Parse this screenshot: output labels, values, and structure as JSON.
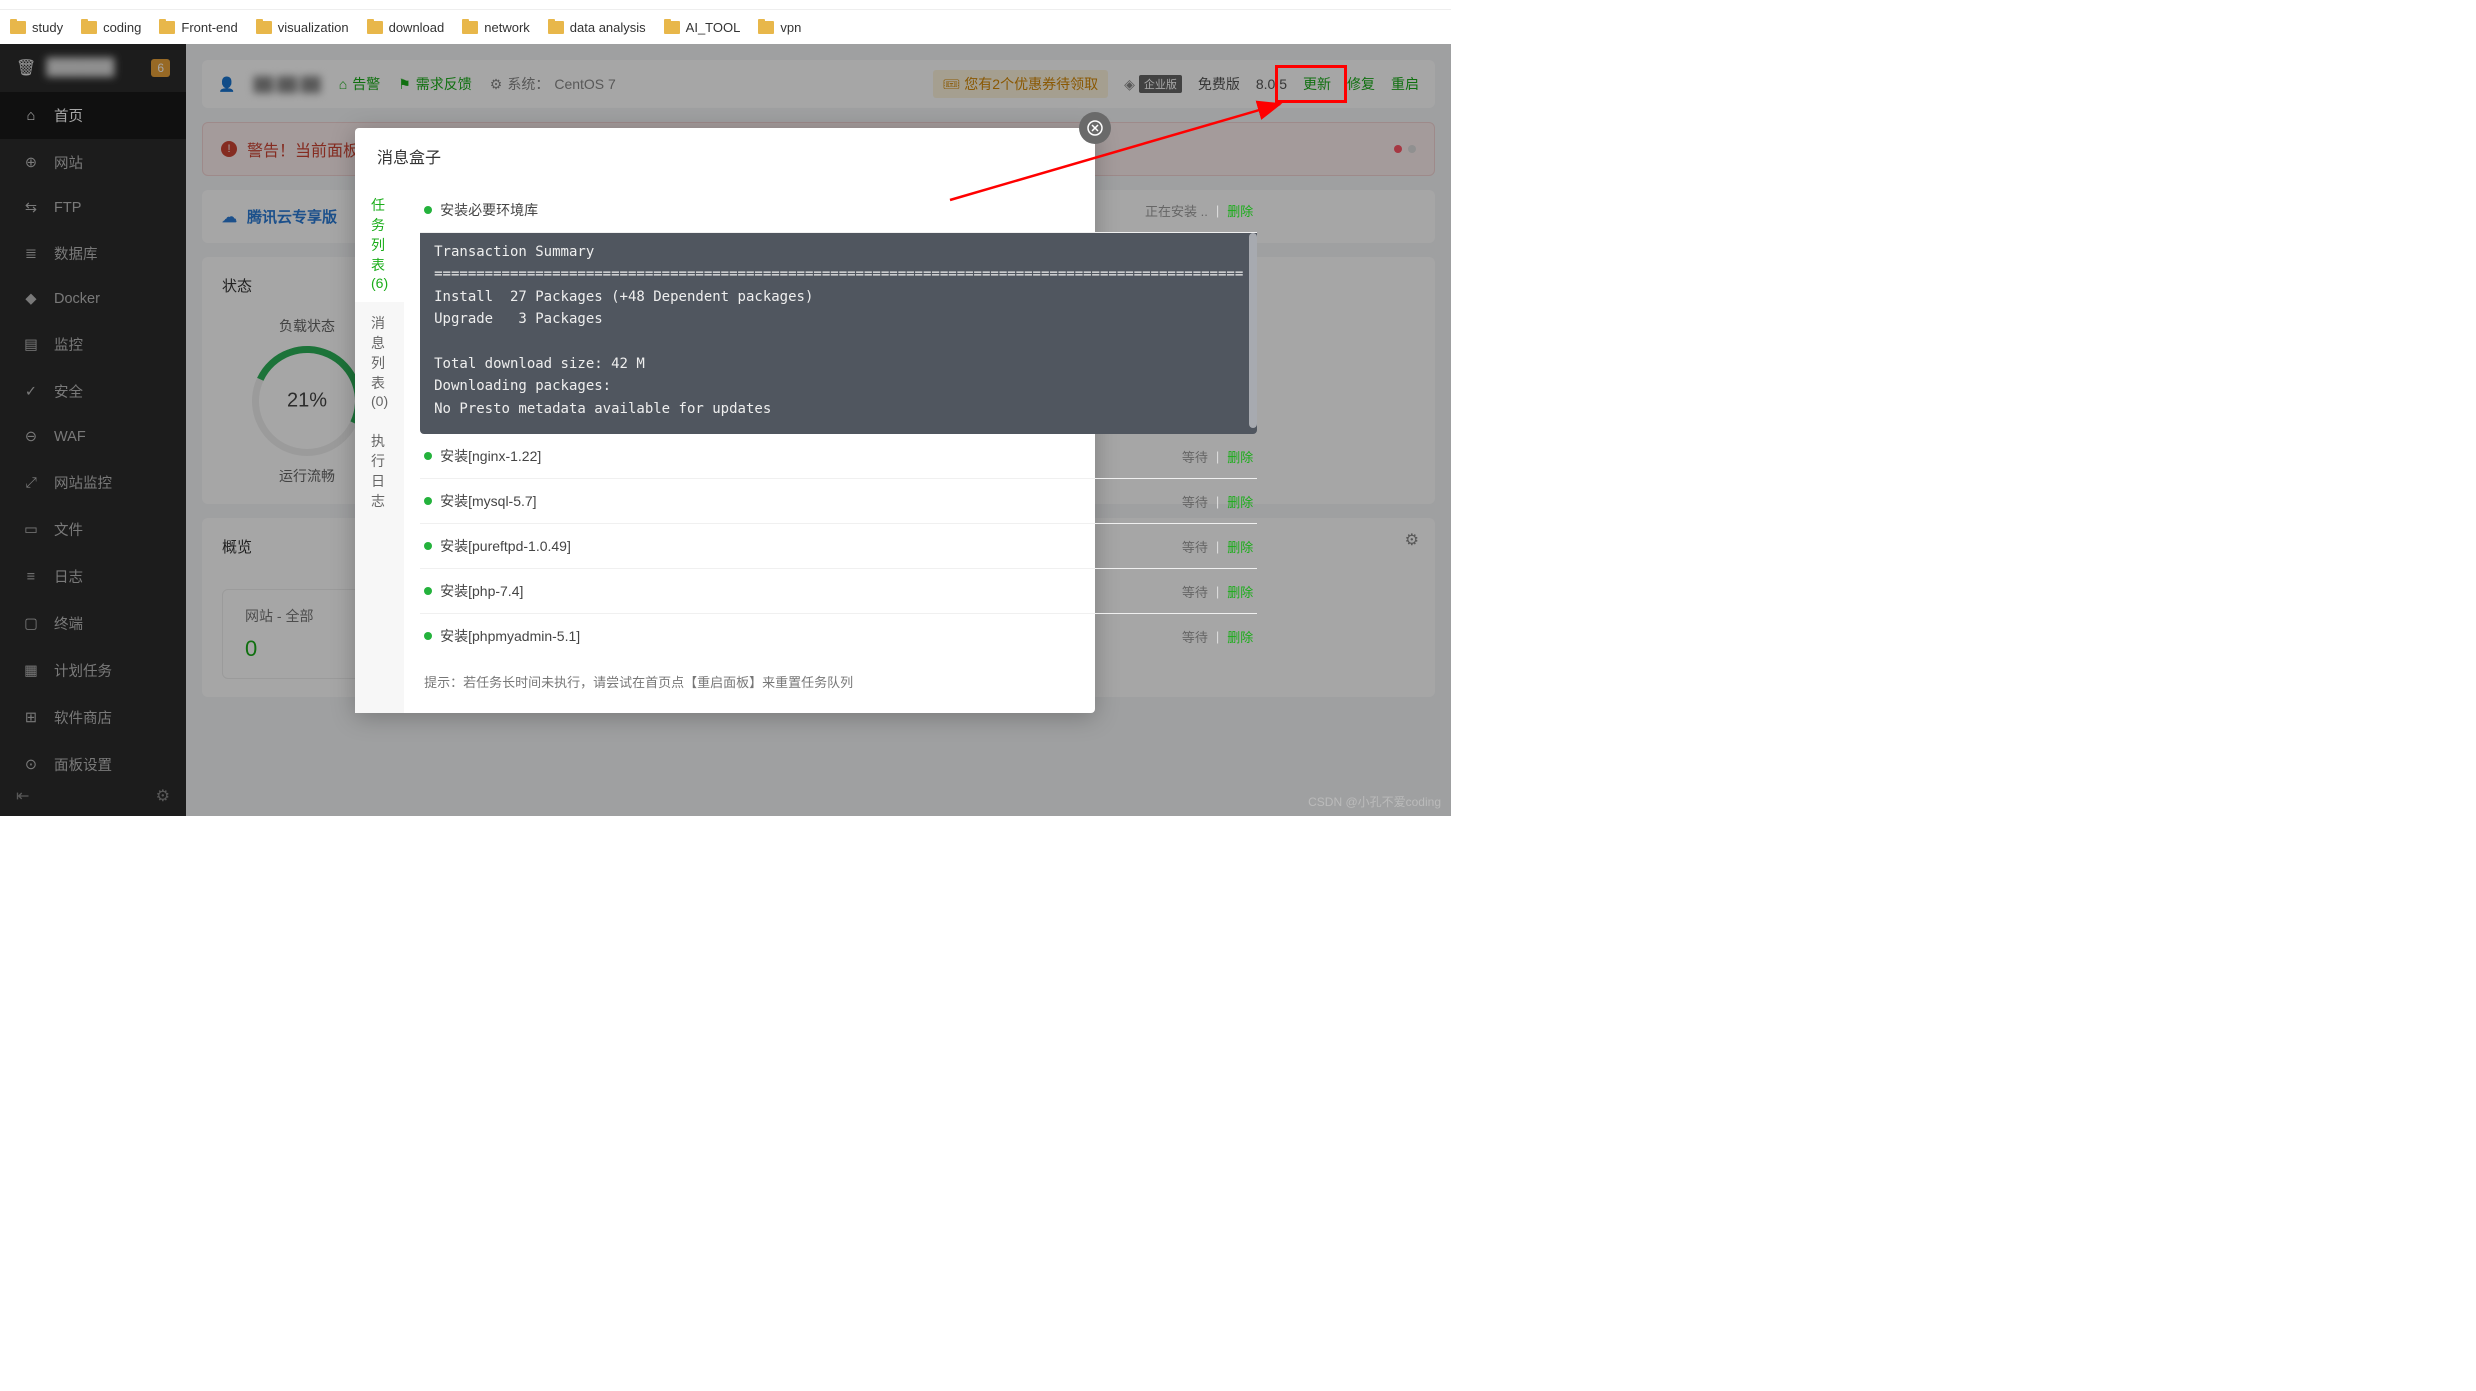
{
  "bookmarks": [
    "study",
    "coding",
    "Front-end",
    "visualization",
    "download",
    "network",
    "data analysis",
    "AI_TOOL",
    "vpn"
  ],
  "sidebar": {
    "badge": "6",
    "items": [
      {
        "label": "首页",
        "icon": "home"
      },
      {
        "label": "网站",
        "icon": "globe"
      },
      {
        "label": "FTP",
        "icon": "ftp"
      },
      {
        "label": "数据库",
        "icon": "db"
      },
      {
        "label": "Docker",
        "icon": "docker"
      },
      {
        "label": "监控",
        "icon": "monitor"
      },
      {
        "label": "安全",
        "icon": "shield"
      },
      {
        "label": "WAF",
        "icon": "waf"
      },
      {
        "label": "网站监控",
        "icon": "sitemon"
      },
      {
        "label": "文件",
        "icon": "folder"
      },
      {
        "label": "日志",
        "icon": "log"
      },
      {
        "label": "终端",
        "icon": "terminal"
      },
      {
        "label": "计划任务",
        "icon": "cron"
      },
      {
        "label": "软件商店",
        "icon": "store"
      },
      {
        "label": "面板设置",
        "icon": "settings"
      }
    ]
  },
  "topbar": {
    "alarm": "告警",
    "feedback": "需求反馈",
    "system_prefix": "系统：",
    "system": "CentOS 7",
    "coupon": "您有2个优惠券待领取",
    "enterprise": "企业版",
    "free": "免费版",
    "version": "8.0.5",
    "update": "更新",
    "repair": "修复",
    "restart": "重启"
  },
  "alert": {
    "text": "警告！当前面板使"
  },
  "tencent": {
    "label": "腾讯云专享版"
  },
  "status": {
    "title": "状态",
    "gauge_title": "负载状态",
    "gauge_value": "21%",
    "gauge_label": "运行流畅"
  },
  "overview": {
    "title": "概览",
    "card_title": "网站 - 全部",
    "card_value": "0"
  },
  "modal": {
    "title": "消息盒子",
    "tabs": {
      "tasks": "任务列表 (6)",
      "messages": "消息列表 (0)",
      "logs": "执行日志"
    },
    "tasks": [
      {
        "name": "安装必要环境库",
        "status": "正在安装 ..",
        "remove": "删除"
      },
      {
        "name": "安装[nginx-1.22]",
        "status": "等待",
        "remove": "删除"
      },
      {
        "name": "安装[mysql-5.7]",
        "status": "等待",
        "remove": "删除"
      },
      {
        "name": "安装[pureftpd-1.0.49]",
        "status": "等待",
        "remove": "删除"
      },
      {
        "name": "安装[php-7.4]",
        "status": "等待",
        "remove": "删除"
      },
      {
        "name": "安装[phpmyadmin-5.1]",
        "status": "等待",
        "remove": "删除"
      }
    ],
    "terminal": "Transaction Summary\n================================================================================================\nInstall  27 Packages (+48 Dependent packages)\nUpgrade   3 Packages\n\nTotal download size: 42 M\nDownloading packages:\nNo Presto metadata available for updates",
    "tip": "提示：若任务长时间未执行，请尝试在首页点【重启面板】来重置任务队列"
  },
  "watermark": "CSDN @小孔不爱coding"
}
